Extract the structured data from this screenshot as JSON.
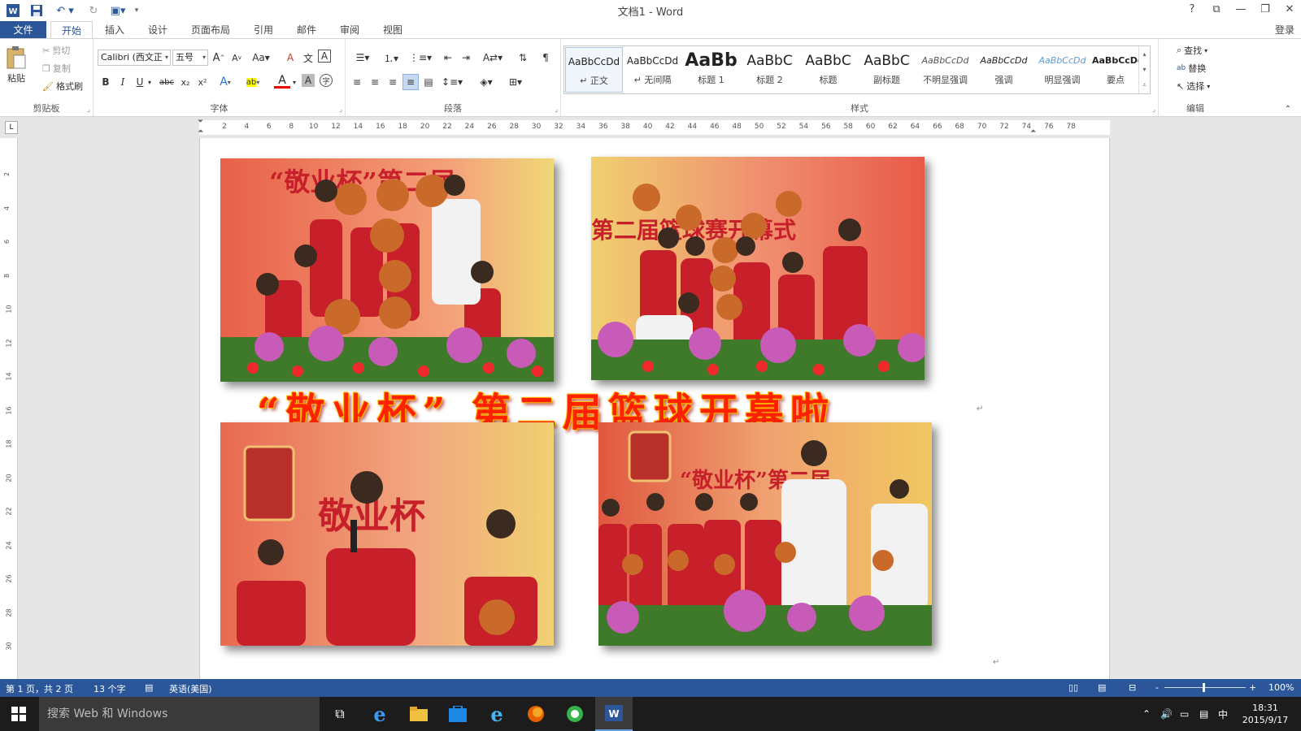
{
  "window": {
    "title": "文档1 - Word"
  },
  "titlebar": {
    "help": "?",
    "ribbon_display": "⧉",
    "minimize": "—",
    "restore": "❐",
    "close": "✕"
  },
  "tabs": [
    {
      "label": "文件"
    },
    {
      "label": "开始"
    },
    {
      "label": "插入"
    },
    {
      "label": "设计"
    },
    {
      "label": "页面布局"
    },
    {
      "label": "引用"
    },
    {
      "label": "邮件"
    },
    {
      "label": "审阅"
    },
    {
      "label": "视图"
    }
  ],
  "login": "登录",
  "clipboard": {
    "paste": "粘贴",
    "cut": "剪切",
    "copy": "复制",
    "format_painter": "格式刷",
    "label": "剪贴板"
  },
  "font": {
    "name": "Calibri (西文正",
    "size": "五号",
    "label": "字体",
    "grow": "A",
    "shrink": "A",
    "case": "Aa",
    "clear": "A",
    "phonetic": "文",
    "border": "A",
    "bold": "B",
    "italic": "I",
    "underline": "U",
    "strike": "abc",
    "sub": "x₂",
    "sup": "x²",
    "effects": "A",
    "highlight": "ab",
    "color": "A",
    "shade": "A",
    "enclose": "字"
  },
  "paragraph": {
    "label": "段落"
  },
  "styles": {
    "label": "样式",
    "items": [
      {
        "preview": "AaBbCcDd",
        "name": "↵ 正文"
      },
      {
        "preview": "AaBbCcDd",
        "name": "↵ 无间隔"
      },
      {
        "preview": "AaBb",
        "name": "标题 1"
      },
      {
        "preview": "AaBbC",
        "name": "标题 2"
      },
      {
        "preview": "AaBbC",
        "name": "标题"
      },
      {
        "preview": "AaBbC",
        "name": "副标题"
      },
      {
        "preview": "AaBbCcDd",
        "name": "不明显强调"
      },
      {
        "preview": "AaBbCcDd",
        "name": "强调"
      },
      {
        "preview": "AaBbCcDd",
        "name": "明显强调"
      },
      {
        "preview": "AaBbCcDd",
        "name": "要点"
      }
    ]
  },
  "editing": {
    "find": "查找",
    "replace": "替换",
    "select": "选择",
    "label": "编辑"
  },
  "ruler": {
    "h_ticks": [
      "2",
      "4",
      "6",
      "8",
      "10",
      "12",
      "14",
      "16",
      "18",
      "20",
      "22",
      "24",
      "26",
      "28",
      "30",
      "32",
      "34",
      "36",
      "38",
      "40",
      "42",
      "44",
      "46",
      "48",
      "50",
      "52",
      "54",
      "56",
      "58",
      "60",
      "62",
      "64",
      "66",
      "68",
      "70",
      "72",
      "74",
      "76",
      "78"
    ],
    "v_ticks": [
      "2",
      "4",
      "6",
      "8",
      "10",
      "12",
      "14",
      "16",
      "18",
      "20",
      "22",
      "24",
      "26",
      "28",
      "30"
    ],
    "corner": "L"
  },
  "document": {
    "headline": "“敬业杯” 第二届篮球开幕啦",
    "photos": [
      {
        "banner": "“敬业杯”第二届",
        "accent": "#e03a2a"
      },
      {
        "banner": "第二届篮球赛开幕式",
        "accent": "#e84430"
      },
      {
        "banner": "敬业杯",
        "accent": "#e8553a"
      },
      {
        "banner": "“敬业杯”第二届",
        "accent": "#d83a28"
      }
    ]
  },
  "statusbar": {
    "page": "第 1 页，共 2 页",
    "words": "13 个字",
    "language": "英语(美国)",
    "zoom": "100%",
    "zoom_minus": "-",
    "zoom_plus": "+"
  },
  "taskbar": {
    "search_placeholder": "搜索 Web 和 Windows",
    "time": "18:31",
    "date": "2015/9/17",
    "ime": "中"
  }
}
